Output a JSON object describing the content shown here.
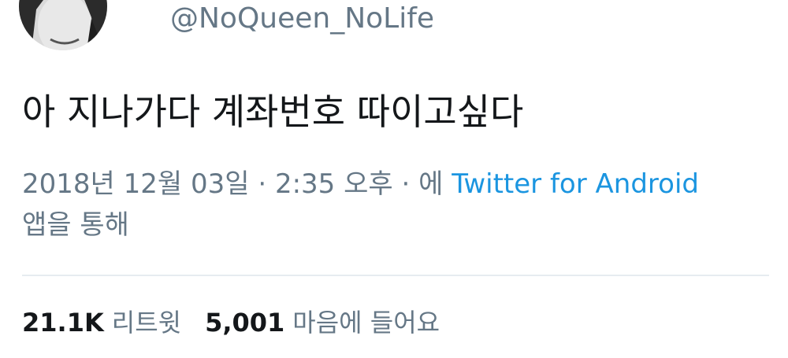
{
  "profile": {
    "handle": "@NoQueen_NoLife",
    "avatar_icon": "profile-avatar"
  },
  "tweet": {
    "text": "아 지나가다 계좌번호 따이고싶다",
    "date": "2018년 12월 03일",
    "separator": " · ",
    "time": "2:35 오후",
    "via_prefix": "에",
    "source": "Twitter for Android",
    "via_suffix": "앱을 통해"
  },
  "stats": {
    "retweets_count": "21.1K",
    "retweets_label": "리트윗",
    "likes_count": "5,001",
    "likes_label": "마음에 들어요"
  },
  "colors": {
    "text": "#14171a",
    "secondary": "#657786",
    "link": "#1b95e0",
    "divider": "#e6ecf0"
  }
}
